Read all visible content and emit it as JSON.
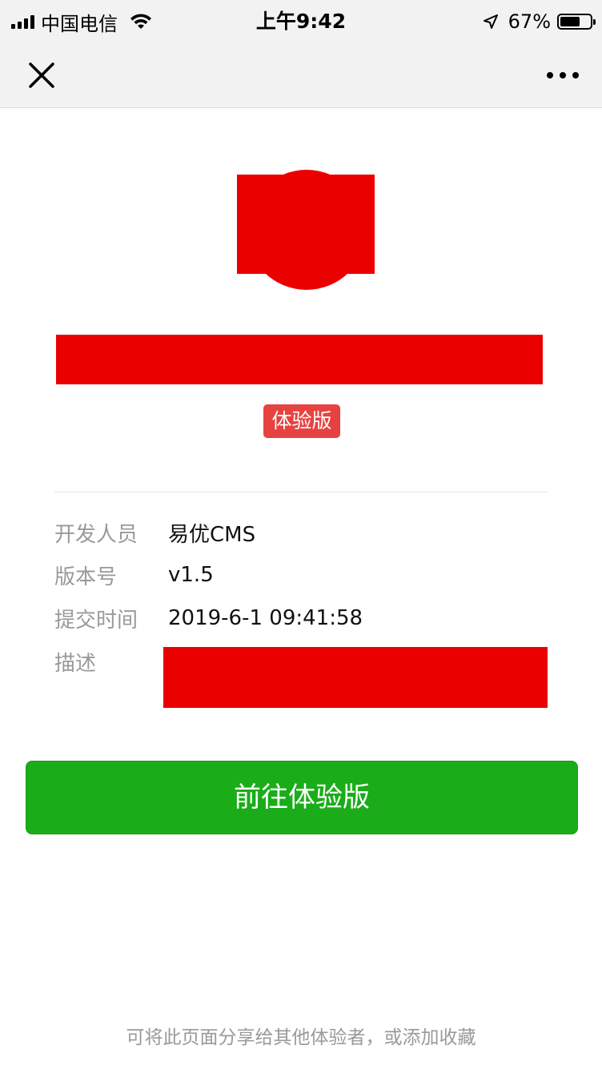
{
  "status_bar": {
    "carrier": "中国电信",
    "time": "上午9:42",
    "battery_percent": "67%",
    "battery_level": 0.67
  },
  "nav": {
    "close_icon": "close-icon",
    "more_icon": "more-icon"
  },
  "app": {
    "badge": "体验版"
  },
  "info": {
    "developer_label": "开发人员",
    "developer_value": "易优CMS",
    "version_label": "版本号",
    "version_value": "v1.5",
    "submit_time_label": "提交时间",
    "submit_time_value": "2019-6-1 09:41:58",
    "description_label": "描述"
  },
  "actions": {
    "go_button": "前往体验版"
  },
  "footer": {
    "tip": "可将此页面分享给其他体验者，或添加收藏"
  },
  "colors": {
    "accent_green": "#1aad19",
    "badge_red": "#e64340",
    "redaction_red": "#eb0000"
  }
}
